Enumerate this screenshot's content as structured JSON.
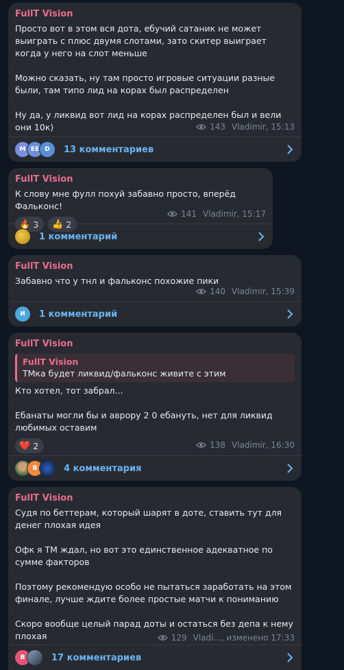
{
  "messages": [
    {
      "author": "FullT Vision",
      "text": "Просто вот в этом вся дота, ебучий сатаник не может выиграть с плюс двумя слотами, зато скитер выиграет когда у него на слот меньше\n\nМожно сказать, ну там просто игровые ситуации разные были, там типо лид на корах был распределен\n\nНу да, у ликвид вот лид на корах распределен был и вели они 10к)",
      "views": "143",
      "signature": "Vladimir, 15:13",
      "comment_avatars": [
        "M",
        "EE",
        "D"
      ],
      "comments_label": "13 комментариев"
    },
    {
      "author": "FullT Vision",
      "text": "К слову мне фулл похуй забавно просто, вперёд Фальконс!",
      "reactions": [
        {
          "emoji": "🔥",
          "count": "3"
        },
        {
          "emoji": "👍",
          "count": "2"
        }
      ],
      "views": "141",
      "signature": "Vladimir, 15:17",
      "comments_label": "1 комментарий"
    },
    {
      "author": "FullT Vision",
      "text": "Забавно что у тнл и фальконс похожие пики",
      "views": "140",
      "signature": "Vladimir, 15:39",
      "comment_avatars": [
        "И"
      ],
      "comments_label": "1 комментарий"
    },
    {
      "author": "FullT Vision",
      "quote_author": "FullT Vision",
      "quote_text": "ТМка будет ликвид/фальконс живите с этим",
      "text": "Кто хотел, тот забрал...\n\nЕбанаты могли бы и аврору 2 0 ебануть, нет для ликвид любимых оставим",
      "reactions": [
        {
          "emoji": "❤️",
          "count": "2"
        }
      ],
      "views": "138",
      "signature": "Vladimir, 16:30",
      "comment_avatars": [
        "",
        "B",
        ""
      ],
      "comments_label": "4 комментария"
    },
    {
      "author": "FullT Vision",
      "text": "Судя по беттерам, который шарят в доте, ставить тут для денег плохая идея\n\nОфк я ТМ ждал, но вот это единственное адекватное по сумме факторов\n\nПоэтому рекомендую особо не пытаться заработать на этом финале, лучше ждите более простые матчи к пониманию\n\nСкоро вообще целый парад доты и остаться без депа к нему плохая",
      "views": "129",
      "signature": "Vladi..., изменено 17:33",
      "comment_avatars": [
        "B",
        ""
      ],
      "comments_label": "17 комментариев"
    }
  ],
  "colors": {
    "background": "#0e1621",
    "bubble": "#272b31",
    "author": "#e86d8e",
    "link": "#6ab3f3",
    "meta": "#7b8590"
  }
}
